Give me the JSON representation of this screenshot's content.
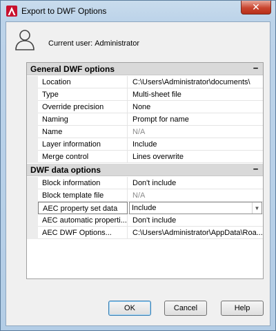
{
  "window": {
    "title": "Export to DWF Options",
    "close_glyph": "✕"
  },
  "user": {
    "label": "Current user:",
    "name": "Administrator"
  },
  "sections": [
    {
      "title": "General DWF options",
      "toggle": "−",
      "rows": [
        {
          "name": "Location",
          "value": "C:\\Users\\Administrator\\documents\\"
        },
        {
          "name": "Type",
          "value": "Multi-sheet file"
        },
        {
          "name": "Override precision",
          "value": "None"
        },
        {
          "name": "Naming",
          "value": "Prompt for name"
        },
        {
          "name": "Name",
          "value": "N/A"
        },
        {
          "name": "Layer information",
          "value": "Include"
        },
        {
          "name": "Merge control",
          "value": "Lines overwrite"
        }
      ]
    },
    {
      "title": "DWF data options",
      "toggle": "−",
      "rows": [
        {
          "name": "Block information",
          "value": "Don't include"
        },
        {
          "name": "Block template file",
          "value": "N/A"
        },
        {
          "name": "AEC property set data",
          "value": "Include"
        },
        {
          "name": "AEC automatic properti...",
          "value": "Don't include"
        },
        {
          "name": "AEC DWF Options...",
          "value": "C:\\Users\\Administrator\\AppData\\Roa..."
        }
      ]
    }
  ],
  "buttons": {
    "ok": "OK",
    "cancel": "Cancel",
    "help": "Help"
  },
  "icons": {
    "app": "autocad-icon",
    "user": "user-icon",
    "dropdown": "chevron-down-icon"
  },
  "colors": {
    "app_icon": "#c8102e",
    "close_button": "#c9452f",
    "section_header": "#d9d9d9",
    "disabled_text": "#8a8a8a"
  }
}
